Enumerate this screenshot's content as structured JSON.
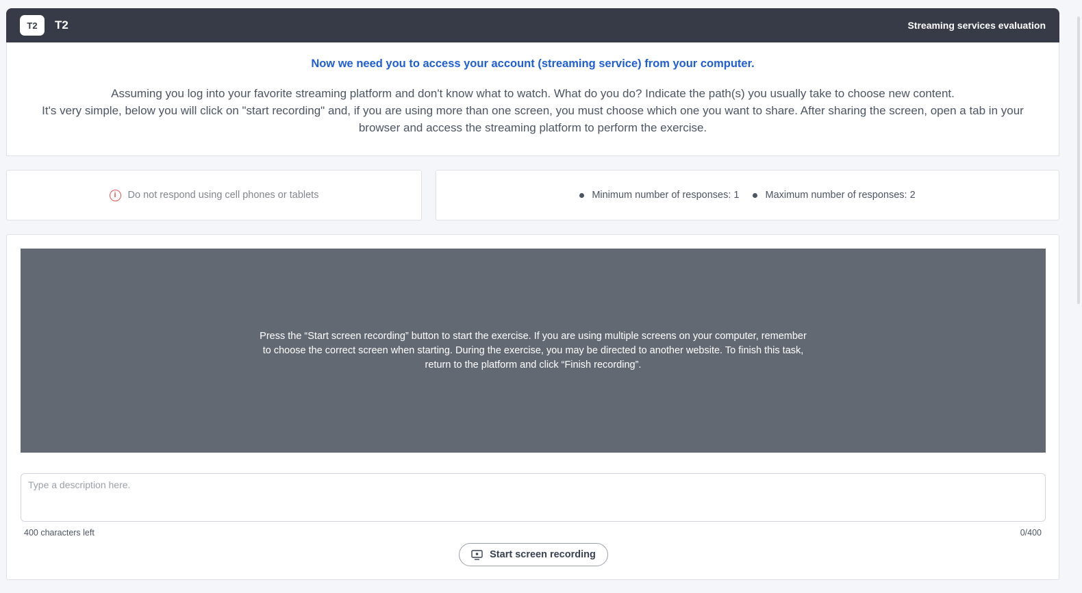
{
  "header": {
    "badge": "T2",
    "title": "T2",
    "subtitle": "Streaming services evaluation"
  },
  "intro": {
    "heading": "Now we need you to access your account (streaming service) from your computer.",
    "line1": "Assuming you log into your favorite streaming platform and don't know what to watch. What do you do? Indicate the path(s) you usually take to choose new content.",
    "line2": "It's very simple, below you will click on \"start recording\" and, if you are using more than one screen, you must choose which one you want to share. After sharing the screen, open a tab in your browser and access the streaming platform to perform the exercise."
  },
  "notice": {
    "icon": "info-circle-icon",
    "text": "Do not respond using cell phones or tablets"
  },
  "responses": {
    "min_label": "Minimum number of responses: 1",
    "max_label": "Maximum number of responses: 2"
  },
  "task": {
    "preview_text": "Press the “Start screen recording” button to start the exercise. If you are using multiple screens on your computer, remember to choose the correct screen when starting. During the exercise, you may be directed to another website. To finish this task, return to the platform and click “Finish recording”.",
    "description": {
      "placeholder": "Type a description here.",
      "value": "",
      "chars_left": "400 characters left",
      "counter": "0/400"
    },
    "record_button": {
      "icon": "screen-record-icon",
      "label": "Start screen recording"
    }
  },
  "colors": {
    "header_bg": "#363b47",
    "heading_blue": "#1d5ed8",
    "warning_red": "#e05252",
    "preview_bg": "#636973"
  }
}
